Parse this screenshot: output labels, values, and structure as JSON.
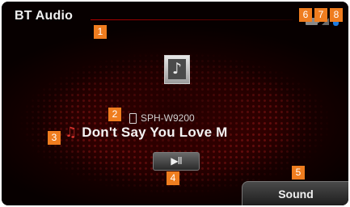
{
  "header": {
    "title": "BT Audio"
  },
  "status_icons": [
    "battery-icon",
    "signal-icon",
    "bluetooth-icon"
  ],
  "device": {
    "name": "SPH-W9200"
  },
  "track": {
    "title": "Don't Say You Love M"
  },
  "controls": {
    "play_pause_label": "▶II",
    "sound_label": "Sound"
  },
  "annotations": [
    "1",
    "2",
    "3",
    "4",
    "5",
    "6",
    "7",
    "8"
  ],
  "colors": {
    "accent_red": "#d8322c",
    "badge_orange": "#ef7d1f",
    "bluetooth_blue": "#1e7be0"
  }
}
